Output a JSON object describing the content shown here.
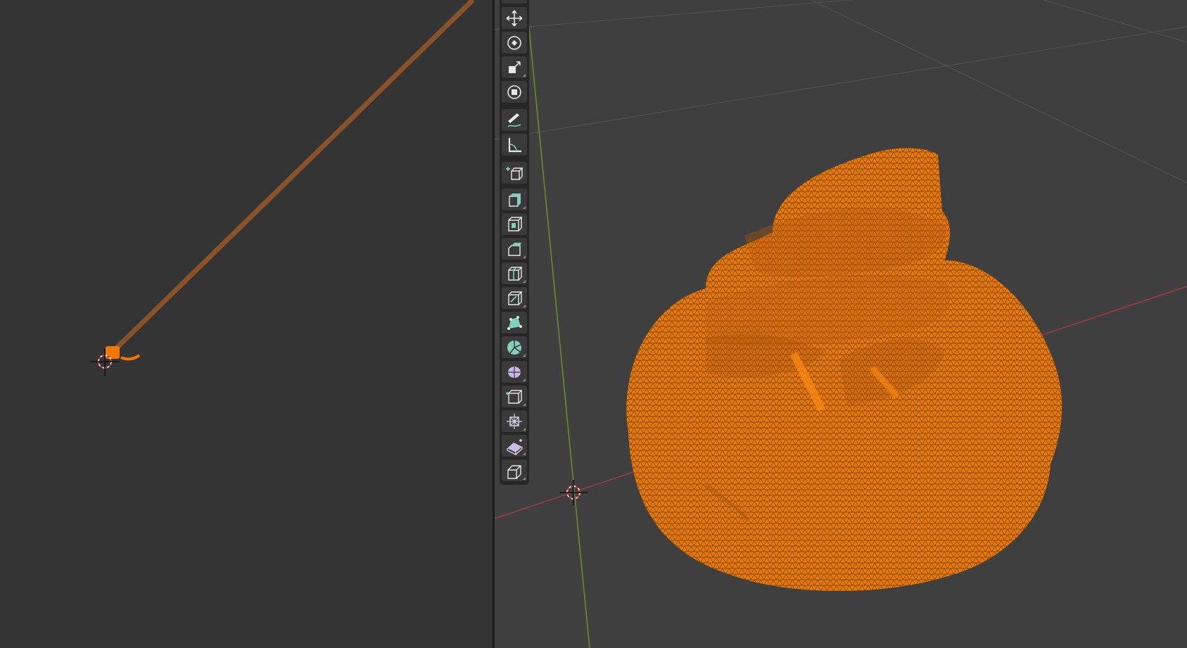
{
  "viewports": {
    "left": {
      "kind": "3D viewport (camera view)"
    },
    "right": {
      "kind": "3D viewport (perspective)"
    }
  },
  "colors": {
    "left_bg": "#343434",
    "right_bg": "#3f3f3f",
    "selection_orange": "#f07800",
    "x_axis": "#9a3b45",
    "y_axis": "#6a8a2a",
    "camera_line": "#8a5228"
  },
  "toolbar": {
    "tools": [
      {
        "name": "move-tool",
        "icon": "move-icon"
      },
      {
        "name": "rotate-tool",
        "icon": "rotate-icon"
      },
      {
        "name": "scale-tool",
        "icon": "scale-icon"
      },
      {
        "name": "transform-tool",
        "icon": "transform-icon"
      },
      {
        "name": "annotate-tool",
        "icon": "annotate-icon"
      },
      {
        "name": "measure-tool",
        "icon": "measure-icon"
      },
      {
        "name": "add-cube-tool",
        "icon": "add-cube-icon"
      },
      {
        "name": "extrude-region-tool",
        "icon": "extrude-icon"
      },
      {
        "name": "inset-faces-tool",
        "icon": "inset-icon"
      },
      {
        "name": "bevel-tool",
        "icon": "bevel-icon"
      },
      {
        "name": "loop-cut-tool",
        "icon": "loop-cut-icon"
      },
      {
        "name": "knife-tool",
        "icon": "knife-icon"
      },
      {
        "name": "poly-build-tool",
        "icon": "poly-build-icon"
      },
      {
        "name": "spin-tool",
        "icon": "spin-icon"
      },
      {
        "name": "smooth-tool",
        "icon": "smooth-icon"
      },
      {
        "name": "edge-slide-tool",
        "icon": "edge-slide-icon"
      },
      {
        "name": "shrink-fatten-tool",
        "icon": "shrink-fatten-icon"
      },
      {
        "name": "shear-tool",
        "icon": "shear-icon"
      },
      {
        "name": "rip-region-tool",
        "icon": "rip-icon"
      }
    ]
  }
}
